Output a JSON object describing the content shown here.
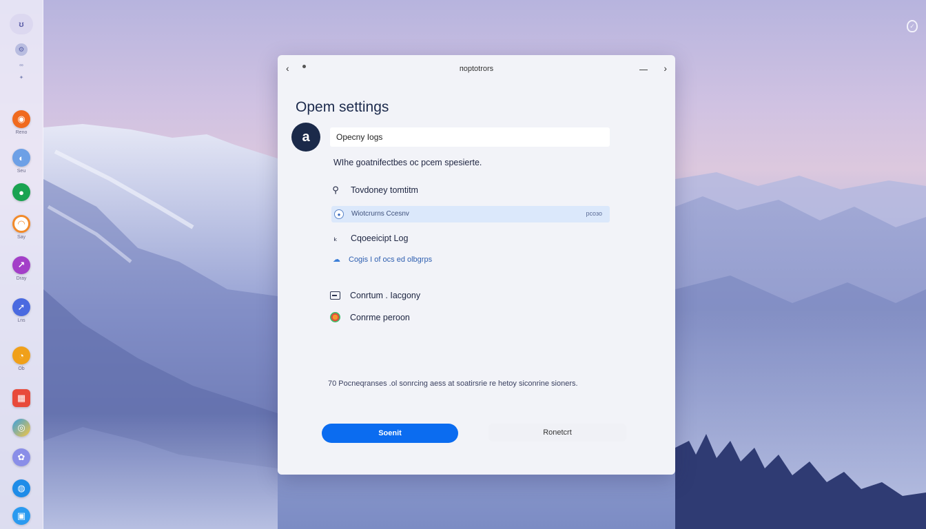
{
  "dock": {
    "top_badge": "ʊ",
    "items": [
      {
        "icon": "app-orange",
        "label": "Reno",
        "color": "#f06a1e"
      },
      {
        "icon": "app-globe",
        "label": "Seu",
        "color": "#6da0e6"
      },
      {
        "icon": "app-green",
        "label": "",
        "color": "#1aa351"
      },
      {
        "icon": "app-orange-ring",
        "label": "Say",
        "color": "#f28a2a"
      },
      {
        "icon": "app-purple",
        "label": "Dray",
        "color": "#a33fc8"
      },
      {
        "icon": "app-compass",
        "label": "Lns",
        "color": "#4a6ae0"
      },
      {
        "icon": "app-amber",
        "label": "Ob",
        "color": "#f0a01a"
      },
      {
        "icon": "app-calendar",
        "label": "",
        "color": "#e84a3a"
      },
      {
        "icon": "app-rainbow",
        "label": "",
        "color": "#3aa0e0"
      },
      {
        "icon": "app-lavender",
        "label": "",
        "color": "#8a8ee8"
      },
      {
        "icon": "app-blue-circle",
        "label": "",
        "color": "#1e8ce8"
      },
      {
        "icon": "app-blue-lock",
        "label": "",
        "color": "#2a9af0"
      }
    ]
  },
  "dialog": {
    "title": "порtоtrоrs",
    "heading": "Opem settings",
    "avatar_letter": "a",
    "name_field_value": "Opecny Iogs",
    "description": "WIhe goatnifectbes oc pcem spesierte.",
    "options": [
      {
        "icon": "search-icon",
        "label": "Tovdoney tomtitm"
      },
      {
        "icon": "tools-icon",
        "label": "Cqoeeicipt Log"
      },
      {
        "icon": "monitor-icon",
        "label": "Conrtum . Iacgony"
      },
      {
        "icon": "color-circle-icon",
        "label": "Conrme peroon"
      }
    ],
    "selected_row": {
      "label": "Wiotcrurns Ccesnv",
      "right": "рсозо"
    },
    "sub_option": "Cogis I of ocs ed olbgrps",
    "footnote": "70 Pocneqranses .ol sonrcing aess at soatirsrie re hetoy siconrine sioners.",
    "primary_button": "Soenit",
    "secondary_button": "Ronetcrt"
  },
  "colors": {
    "accent": "#0b6cf0",
    "selection": "#dbe8fb",
    "dialog_bg": "#f2f3f8",
    "avatar_bg": "#1b2a4a"
  }
}
